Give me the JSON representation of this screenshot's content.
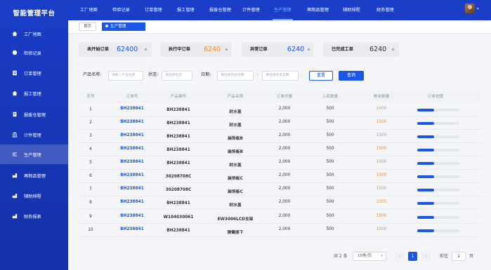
{
  "app": {
    "title": "智能管理平台"
  },
  "sidebar": {
    "items": [
      {
        "label": "工厂地图",
        "icon": "home-icon"
      },
      {
        "label": "检验记录",
        "icon": "record-icon"
      },
      {
        "label": "订单管理",
        "icon": "order-icon"
      },
      {
        "label": "报工管理",
        "icon": "report-icon"
      },
      {
        "label": "报废仓管理",
        "icon": "scrap-icon"
      },
      {
        "label": "计件管理",
        "icon": "piece-icon"
      },
      {
        "label": "生产管理",
        "icon": "production-icon",
        "active": true
      },
      {
        "label": "再制品管理",
        "icon": "remanufacture-icon"
      },
      {
        "label": "辅助排程",
        "icon": "schedule-icon"
      },
      {
        "label": "财务报表",
        "icon": "finance-icon"
      }
    ]
  },
  "topnav": {
    "items": [
      {
        "label": "工厂地图"
      },
      {
        "label": "检验记录"
      },
      {
        "label": "订单管理"
      },
      {
        "label": "报工管理"
      },
      {
        "label": "报废仓管理"
      },
      {
        "label": "计件管理"
      },
      {
        "label": "生产管理",
        "active": true
      },
      {
        "label": "再制品管理"
      },
      {
        "label": "辅助排程"
      },
      {
        "label": "财务管理"
      }
    ]
  },
  "breadcrumb": {
    "home": "首页",
    "current": "生产管理"
  },
  "stats": [
    {
      "label": "未开始订单",
      "value": "62400",
      "color": "#1a56e8"
    },
    {
      "label": "执行中订单",
      "value": "6240",
      "color": "#f08c1e"
    },
    {
      "label": "异常订单",
      "value": "6240",
      "color": "#1a56e8"
    },
    {
      "label": "已完成工单",
      "value": "6240",
      "color": "#333333"
    }
  ],
  "search": {
    "product_label": "产品名称:",
    "product_placeholder": "请输入产品名称",
    "status_label": "状态:",
    "status_placeholder": "请选择状态",
    "date_label": "日期:",
    "start_placeholder": "请选择开始日期",
    "dash": "-",
    "end_placeholder": "请选择结束日期",
    "reset": "重置",
    "query": "查询"
  },
  "table": {
    "headers": [
      "序号",
      "订单号",
      "产品编号",
      "产品名称",
      "订单总量",
      "入库数量",
      "剩余数量",
      "订单进度"
    ],
    "rows": [
      {
        "no": "1",
        "order": "BH238841",
        "code": "BH238841",
        "name": "封水盖",
        "total": "2,000",
        "stock": "500",
        "remain": "1500",
        "progress": 0.4
      },
      {
        "no": "2",
        "order": "BH238841",
        "code": "BH238841",
        "name": "封水盖",
        "total": "2,000",
        "stock": "500",
        "remain": "1500",
        "progress": 0.4
      },
      {
        "no": "3",
        "order": "BH238841",
        "code": "BH238841",
        "name": "装饰板B",
        "total": "2,000",
        "stock": "500",
        "remain": "1500",
        "progress": 0.4
      },
      {
        "no": "4",
        "order": "BH238841",
        "code": "BH238841",
        "name": "装饰板B",
        "total": "2,000",
        "stock": "500",
        "remain": "1500",
        "progress": 0.4
      },
      {
        "no": "5",
        "order": "BH238841",
        "code": "BH238841",
        "name": "封水盖",
        "total": "2,000",
        "stock": "500",
        "remain": "1500",
        "progress": 0.4
      },
      {
        "no": "6",
        "order": "BH238841",
        "code": "30208708C",
        "name": "装饰板C",
        "total": "2,000",
        "stock": "500",
        "remain": "1500",
        "progress": 0.4
      },
      {
        "no": "7",
        "order": "BH238841",
        "code": "30208708C",
        "name": "装饰板C",
        "total": "2,000",
        "stock": "500",
        "remain": "1500",
        "progress": 0.4
      },
      {
        "no": "8",
        "order": "BH238841",
        "code": "BH238841",
        "name": "封水盖",
        "total": "2,000",
        "stock": "500",
        "remain": "1500",
        "progress": 0.4
      },
      {
        "no": "9",
        "order": "BH238841",
        "code": "W104030061",
        "name": "EW3006LCD支架",
        "total": "2,000",
        "stock": "500",
        "remain": "1500",
        "progress": 0.4
      },
      {
        "no": "10",
        "order": "BH238841",
        "code": "BH238841",
        "name": "弹簧座下",
        "total": "2,000",
        "stock": "500",
        "remain": "1500",
        "progress": 0.4
      }
    ]
  },
  "pagination": {
    "total": "共 2 条",
    "page_size": "10条/页",
    "prev": "‹",
    "current": "1",
    "next": "›",
    "goto_label": "前往",
    "goto_value": "1",
    "page_suffix": "页"
  }
}
